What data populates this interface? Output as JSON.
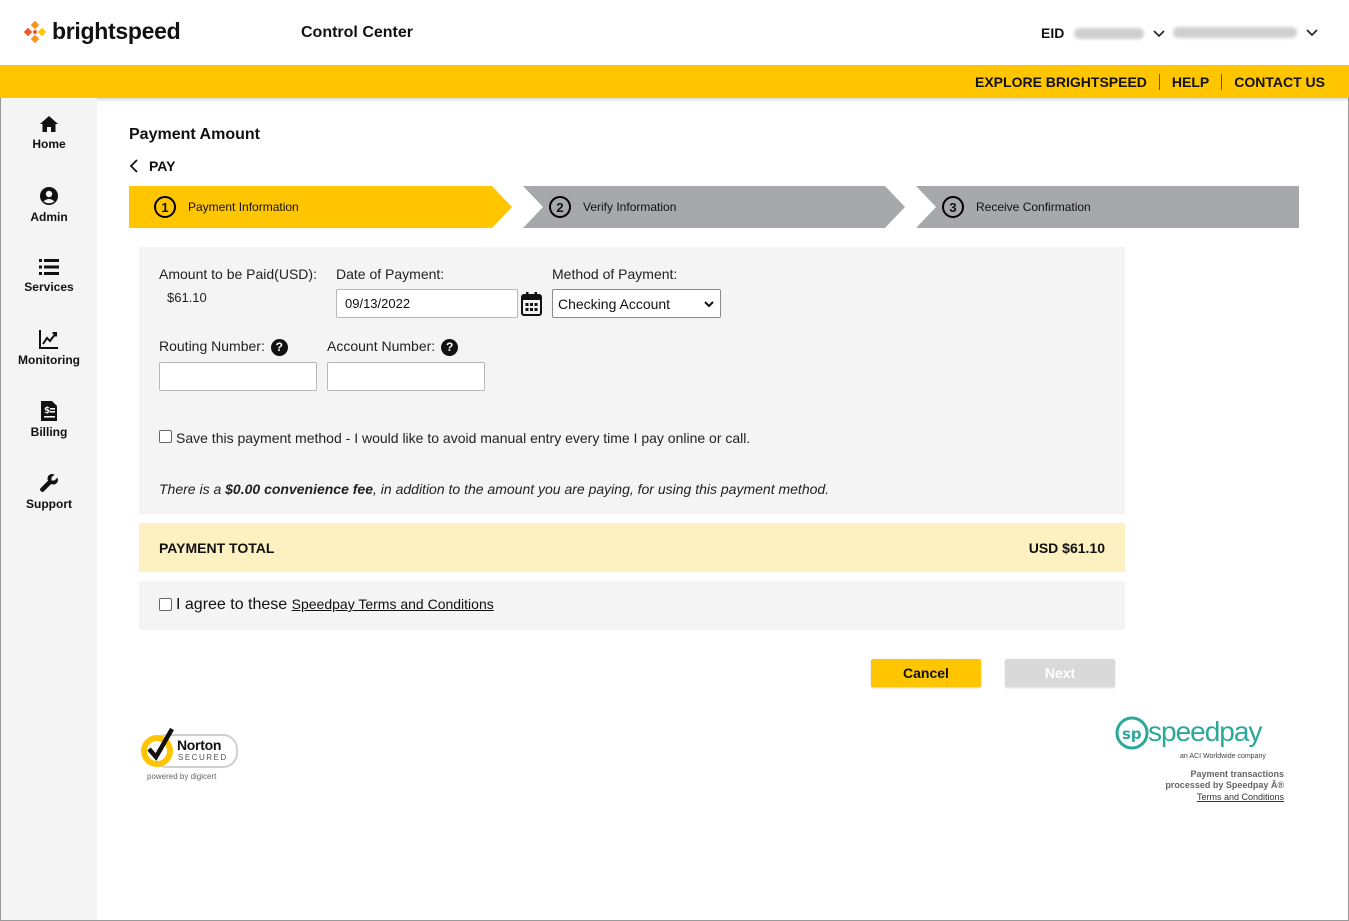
{
  "header": {
    "brand": "brightspeed",
    "app_title": "Control Center",
    "eid_label": "EID"
  },
  "top_links": [
    "EXPLORE BRIGHTSPEED",
    "HELP",
    "CONTACT US"
  ],
  "sidebar": {
    "items": [
      {
        "label": "Home",
        "icon": "home-icon"
      },
      {
        "label": "Admin",
        "icon": "user-circle-icon"
      },
      {
        "label": "Services",
        "icon": "list-icon"
      },
      {
        "label": "Monitoring",
        "icon": "chart-line-icon"
      },
      {
        "label": "Billing",
        "icon": "invoice-icon"
      },
      {
        "label": "Support",
        "icon": "wrench-icon"
      }
    ]
  },
  "page": {
    "title": "Payment Amount",
    "back_label": "PAY"
  },
  "stepper": {
    "steps": [
      {
        "number": "1",
        "label": "Payment Information",
        "active": true
      },
      {
        "number": "2",
        "label": "Verify Information",
        "active": false
      },
      {
        "number": "3",
        "label": "Receive Confirmation",
        "active": false
      }
    ]
  },
  "form": {
    "amount_label": "Amount to be Paid(USD):",
    "amount_value": "$61.10",
    "date_label": "Date of Payment:",
    "date_value": "09/13/2022",
    "method_label": "Method of Payment:",
    "method_value": "Checking Account",
    "routing_label": "Routing Number:",
    "routing_value": "",
    "account_label": "Account Number:",
    "account_value": "",
    "help_glyph": "?",
    "save_label": "Save this payment method - I would like to avoid manual entry every time I pay online or call.",
    "fee_prefix": "There is a ",
    "fee_bold": "$0.00 convenience fee",
    "fee_suffix": ", in addition to the amount you are paying, for using this payment method."
  },
  "total": {
    "label": "PAYMENT TOTAL",
    "value": "USD $61.10"
  },
  "agree": {
    "label": "I agree to these ",
    "link": "Speedpay Terms and Conditions"
  },
  "buttons": {
    "cancel": "Cancel",
    "next": "Next"
  },
  "norton": {
    "name": "Norton",
    "secured": "SECURED",
    "powered": "powered by digicert"
  },
  "speedpay": {
    "brand": "speedpay",
    "tagline": "an ACI Worldwide company",
    "line1": "Payment transactions",
    "line2": "processed by Speedpay Â®",
    "terms": "Terms and Conditions"
  },
  "colors": {
    "brand_yellow": "#FFC600",
    "step_inactive": "#A6A8AB",
    "total_bg": "#FDF0C1",
    "speedpay_teal": "#2CA89A"
  }
}
